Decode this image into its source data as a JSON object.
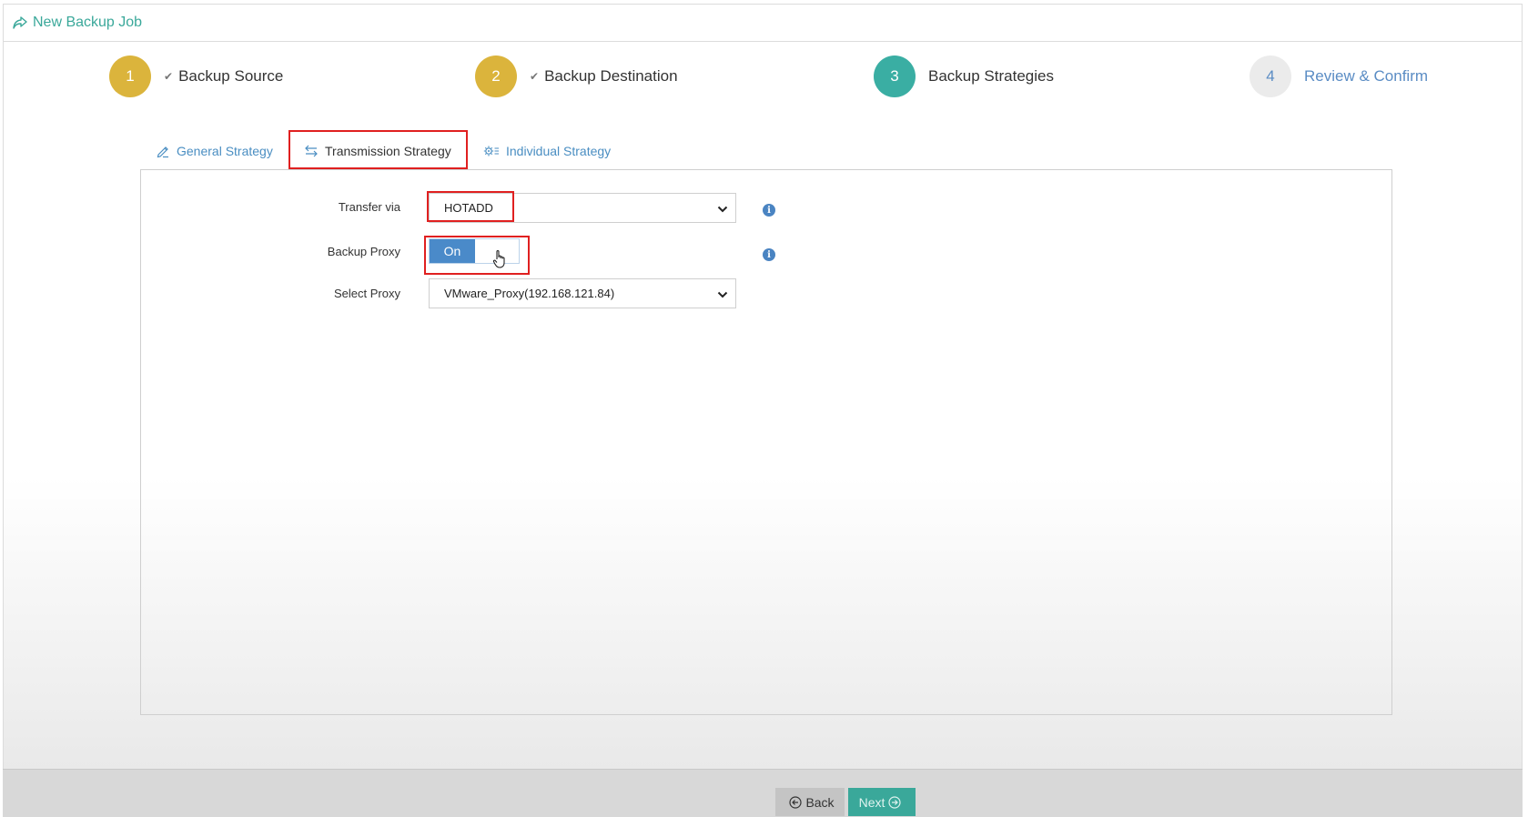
{
  "header": {
    "title": "New Backup Job",
    "icon": "share-arrow-icon"
  },
  "steps": [
    {
      "number": "1",
      "label": "Backup Source",
      "state": "done",
      "color": "#dbb43c"
    },
    {
      "number": "2",
      "label": "Backup Destination",
      "state": "done",
      "color": "#dbb43c"
    },
    {
      "number": "3",
      "label": "Backup Strategies",
      "state": "current",
      "color": "#3aaea3"
    },
    {
      "number": "4",
      "label": "Review & Confirm",
      "state": "pending",
      "color": "#ebebeb"
    }
  ],
  "tabs": [
    {
      "label": "General Strategy",
      "icon": "pencil-icon"
    },
    {
      "label": "Transmission Strategy",
      "icon": "transfer-arrows-icon",
      "active": true
    },
    {
      "label": "Individual Strategy",
      "icon": "gear-list-icon"
    }
  ],
  "form": {
    "transfer_via": {
      "label": "Transfer via",
      "value": "HOTADD"
    },
    "backup_proxy": {
      "label": "Backup Proxy",
      "toggle_text": "On"
    },
    "select_proxy": {
      "label": "Select Proxy",
      "value": "VMware_Proxy(192.168.121.84)"
    }
  },
  "footer": {
    "back_label": "Back",
    "next_label": "Next"
  },
  "colors": {
    "accent": "#3aa89a",
    "link": "#4a8ec2",
    "highlight": "#e02020"
  }
}
